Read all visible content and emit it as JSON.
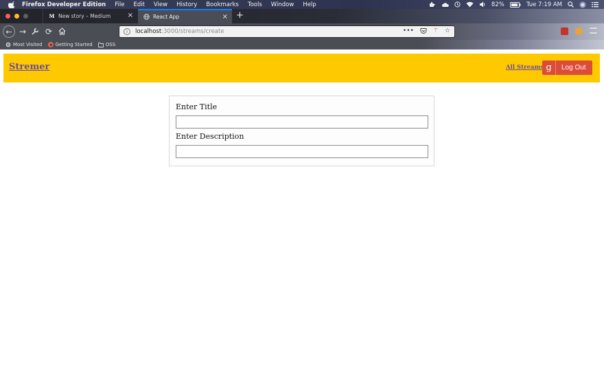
{
  "menubar": {
    "app_name": "Firefox Developer Edition",
    "items": [
      "File",
      "Edit",
      "View",
      "History",
      "Bookmarks",
      "Tools",
      "Window",
      "Help"
    ],
    "battery": "82%",
    "clock": "Tue 7:19 AM"
  },
  "tabs": [
    {
      "title": "New story – Medium",
      "favicon": "M"
    },
    {
      "title": "React App"
    }
  ],
  "url": {
    "host": "localhost",
    "path": ":3000/streams/create"
  },
  "bookmarks": [
    {
      "label": "Most Visited"
    },
    {
      "label": "Getting Started"
    },
    {
      "label": "OSS"
    }
  ],
  "app": {
    "brand": "Stremer",
    "nav_all_streams": "All Streams",
    "logout_label": "Log Out",
    "google_glyph": "g",
    "accent_color": "#ffc900",
    "button_color": "#dd4b39"
  },
  "form": {
    "title_label": "Enter Title",
    "title_value": "",
    "description_label": "Enter Description",
    "description_value": ""
  }
}
